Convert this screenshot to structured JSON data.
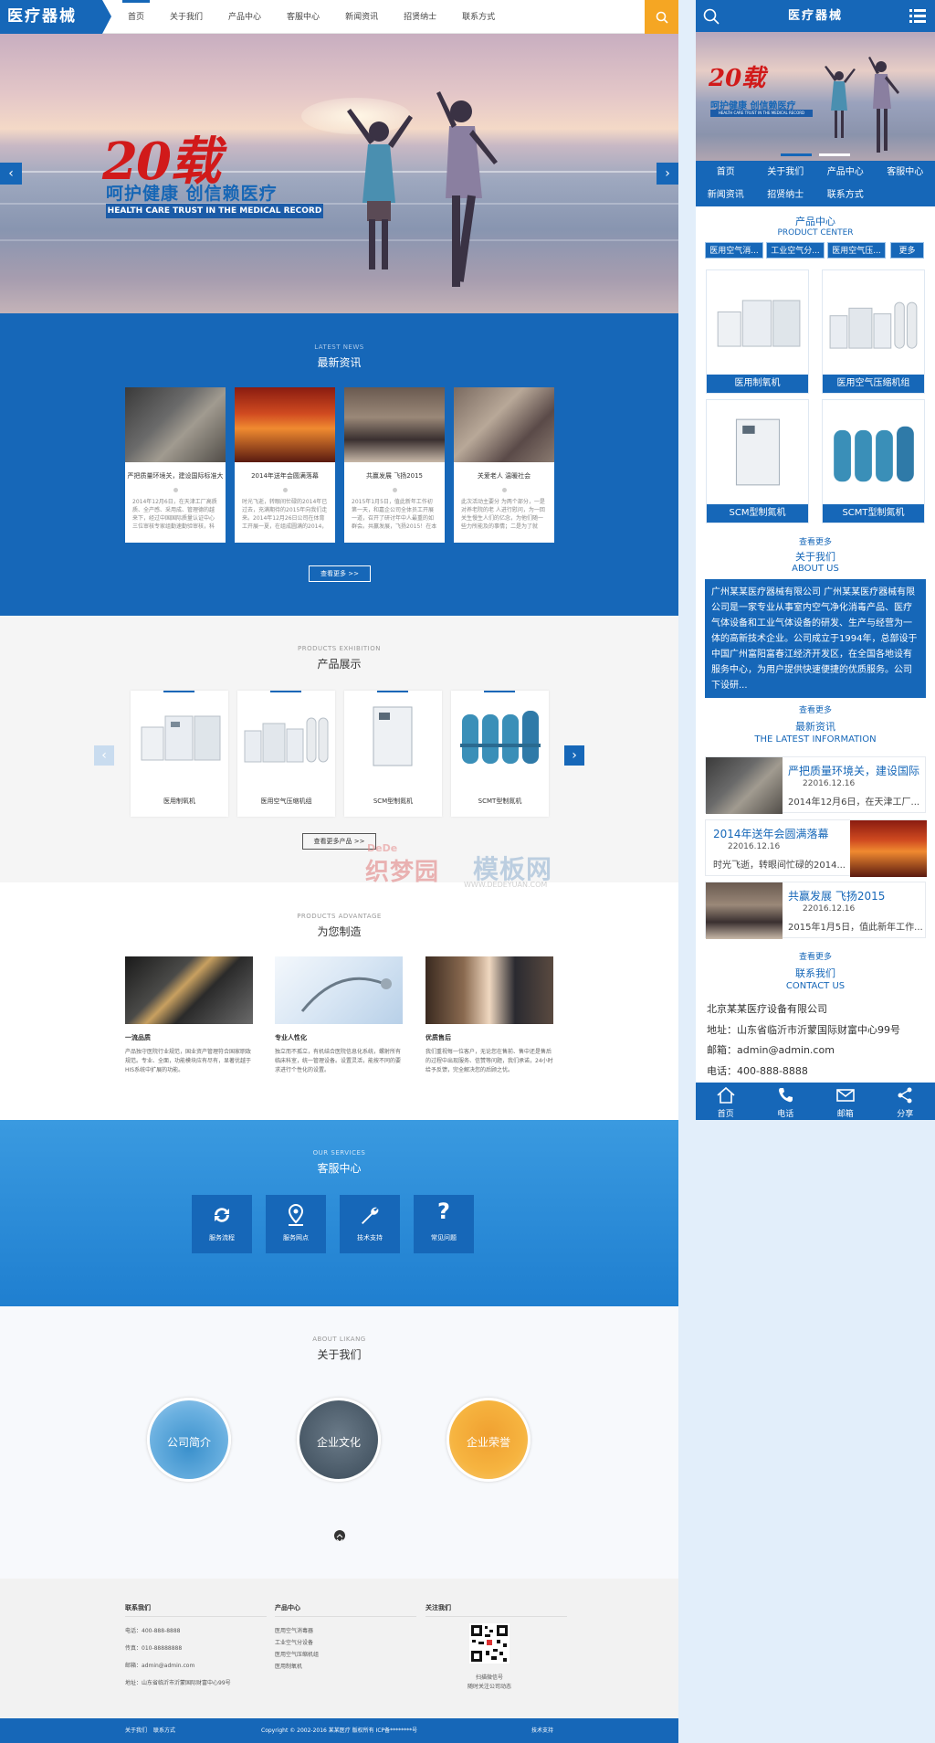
{
  "logo": {
    "text": "医疗器械"
  },
  "nav": {
    "items": [
      "首页",
      "关于我们",
      "产品中心",
      "客服中心",
      "新闻资讯",
      "招贤纳士",
      "联系方式"
    ]
  },
  "banner": {
    "big": "20载",
    "slogan": "呵护健康  创信赖医疗",
    "slogan_en": "HEALTH CARE TRUST IN THE MEDICAL RECORD",
    "prev": "‹",
    "next": "›"
  },
  "news": {
    "en": "LATEST NEWS",
    "cn": "最新资讯",
    "items": [
      {
        "title": "严把质量环境关，建设国际标准大",
        "desc": "2014年12月6日，在天津工厂高质质、全产感、采用成、管理德的越来下，经过中国国际质量认证中心三位审核专家组勤速勤验审核，科属天津..."
      },
      {
        "title": "2014年送年会圆满落幕",
        "desc": "时光飞逝，转眼间忙碌的2014年已过去，充满期待的2015年向我们走来。2014年12月26日公司在体育工开展一夏，在组成圆满的2014，共同期待..."
      },
      {
        "title": "共赢发展 飞扬2015",
        "desc": "2015年1月5日，值此新年工作初第一天，和嘉企公司全体员工开展一道，召开了研讨年中人最重的如群会。共赢发展，飞扬2015！在本次会议..."
      },
      {
        "title": "关爱老人 温暖社会",
        "desc": "此次活动主要分 为两个部分，一是对养老院的老 人进行慰问，为一回关生慢生人们的亿念，为他们随一些力所能及的事情；二是为了就事..."
      }
    ],
    "more": "查看更多 >>"
  },
  "exhibit": {
    "en": "PRODUCTS EXHIBITION",
    "cn": "产品展示",
    "items": [
      "医用制氧机",
      "医用空气压缩机组",
      "SCM型制氮机",
      "SCMT型制氮机"
    ],
    "more": "查看更多产品 >>",
    "prev": "‹",
    "next": "›"
  },
  "advantage": {
    "en": "PRODUCTS ADVANTAGE",
    "cn": "为您制造",
    "items": [
      {
        "title": "一流品质",
        "desc": "产品独守医院行业规范，国业资产管理符合国家职政规范。专业、全面，功能模块应有尽有，显著优越于HIS系统中扩展的功能。"
      },
      {
        "title": "专业人性化",
        "desc": "独立而不孤立，有机结合医院信息化系统，螺射所有临床科室，统一管理设备。设置灵活，能按不同的要求进行个性化的设置。"
      },
      {
        "title": "优质售后",
        "desc": "我们重视每一位客户，无论您在售前、售中还是售后的过程中出现服务、信赞等问题，我们承诺，24小时给予反馈，完全解决您的后顾之忧。"
      }
    ]
  },
  "services": {
    "en": "OUR SERVICES",
    "cn": "客服中心",
    "items": [
      "服务流程",
      "服务网点",
      "技术支持",
      "常见问题"
    ]
  },
  "about": {
    "en": "ABOUT LIKANG",
    "cn": "关于我们",
    "circles": [
      "公司简介",
      "企业文化",
      "企业荣誉"
    ]
  },
  "footer": {
    "contact": {
      "h": "联系我们",
      "phone": "电话：400-888-8888",
      "fax": "传真：010-88888888",
      "email": "邮箱：admin@admin.com",
      "addr": "地址：山东省临沂市沂蒙国际财富中心99号"
    },
    "products": {
      "h": "产品中心",
      "items": [
        "医用空气消毒器",
        "工业空气分设备",
        "医用空气压缩机组",
        "医用制氧机"
      ]
    },
    "follow": {
      "h": "关注我们",
      "line1": "扫描微信号",
      "line2": "随时关注公司动态"
    }
  },
  "copyright": {
    "left1": "关于我们",
    "left2": "联系方式",
    "center": "Copyright © 2002-2016 某某医疗 版权所有  ICP备********号",
    "right": "技术支持"
  },
  "watermark": {
    "line1": "织梦园",
    "line2": "模板网",
    "url": "WWW.DEDEYUAN.COM",
    "brand": "DeDe"
  },
  "mobile": {
    "logo": "医疗器械",
    "nav": [
      "首页",
      "关于我们",
      "产品中心",
      "客服中心",
      "新闻资讯",
      "招贤纳士",
      "联系方式"
    ],
    "product_cn": "产品中心",
    "product_en": "PRODUCT CENTER",
    "tabs": [
      "医用空气消...",
      "工业空气分...",
      "医用空气压...",
      "更多"
    ],
    "products": [
      "医用制氧机",
      "医用空气压缩机组",
      "SCM型制氮机",
      "SCMT型制氮机"
    ],
    "more": "查看更多",
    "about_cn": "关于我们",
    "about_en": "ABOUT US",
    "about_text": "广州某某医疗器械有限公司 广州某某医疗器械有限公司是一家专业从事室内空气净化消毒产品、医疗气体设备和工业气体设备的研发、生产与经营为一体的高新技术企业。公司成立于1994年，总部设于中国广州富阳富春江经济开发区，在全国各地设有服务中心，为用户提供快速便捷的优质服务。公司下设研...",
    "news_cn": "最新资讯",
    "news_en": "THE LATEST INFORMATION",
    "news": [
      {
        "title": "严把质量环境关，建设国际",
        "date": "22016.12.16",
        "desc": "2014年12月6日，在天津工厂..."
      },
      {
        "title": "2014年送年会圆满落幕",
        "date": "22016.12.16",
        "desc": "时光飞逝，转眼间忙碌的2014..."
      },
      {
        "title": "共赢发展 飞扬2015",
        "date": "22016.12.16",
        "desc": "2015年1月5日，值此新年工作..."
      }
    ],
    "contact_cn": "联系我们",
    "contact_en": "CONTACT US",
    "company": "北京某某医疗设备有限公司",
    "addr": "地址：山东省临沂市沂蒙国际财富中心99号",
    "email": "邮箱：admin@admin.com",
    "phone": "电话：400-888-8888",
    "footer": [
      "首页",
      "电话",
      "邮箱",
      "分享"
    ]
  },
  "colors": {
    "primary": "#1667b8",
    "accent": "#f5a623",
    "bg": "#e2eefa"
  }
}
